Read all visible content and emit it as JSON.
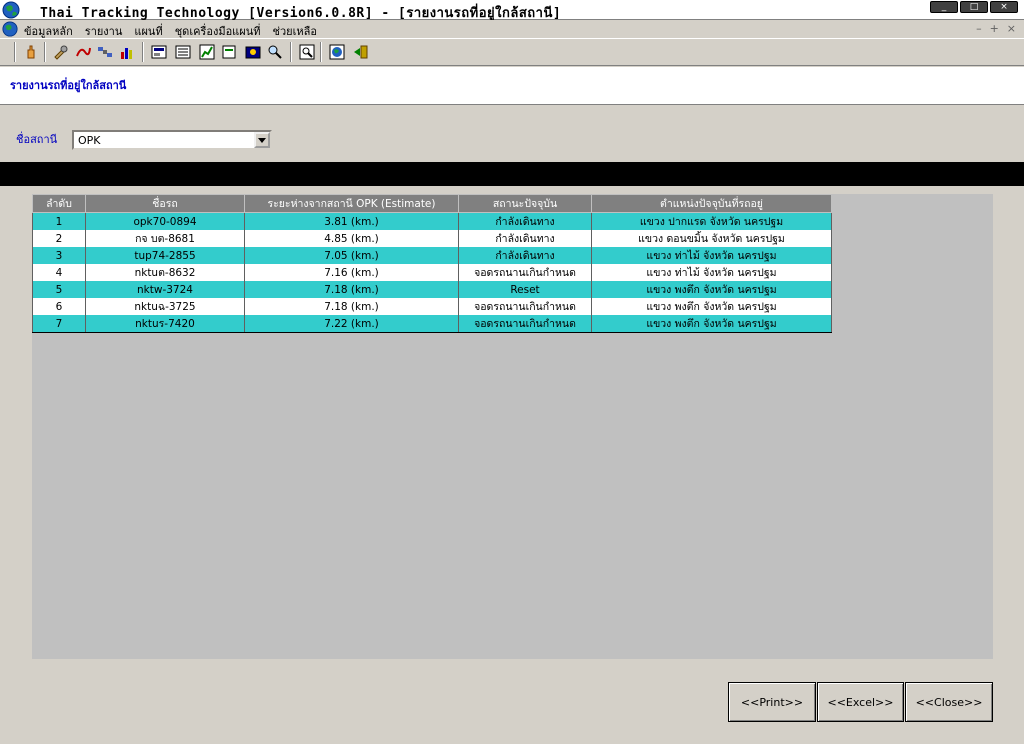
{
  "window": {
    "title": "Thai Tracking Technology [Version6.0.8R] - [รายงานรถที่อยู่ใกล้สถานี]",
    "controls": [
      "_",
      "□",
      "×"
    ]
  },
  "menu": {
    "items": [
      "ข้อมูลหลัก",
      "รายงาน",
      "แผนที่",
      "ชุดเครื่องมือแผนที่",
      "ช่วยเหลือ"
    ],
    "mdi_controls": [
      "–",
      "+",
      "×"
    ]
  },
  "page": {
    "title": "รายงานรถที่อยู่ใกล้สถานี"
  },
  "filter": {
    "label": "ชื่อสถานี",
    "station_value": "OPK"
  },
  "table": {
    "headers": [
      "ลำดับ",
      "ชื่อรถ",
      "ระยะห่างจากสถานี OPK (Estimate)",
      "สถานะปัจจุบัน",
      "ตำแหน่งปัจจุบันที่รถอยู่"
    ],
    "rows": [
      [
        "1",
        "opk70-0894",
        "3.81 (km.)",
        "กำลังเดินทาง",
        "แขวง ปากแรด จังหวัด นครปฐม"
      ],
      [
        "2",
        "กจ บต-8681",
        "4.85 (km.)",
        "กำลังเดินทาง",
        "แขวง ดอนขมิ้น จังหวัด นครปฐม"
      ],
      [
        "3",
        "tup74-2855",
        "7.05 (km.)",
        "กำลังเดินทาง",
        "แขวง ท่าไม้ จังหวัด นครปฐม"
      ],
      [
        "4",
        "nktuต-8632",
        "7.16 (km.)",
        "จอดรถนานเกินกำหนด",
        "แขวง ท่าไม้ จังหวัด นครปฐม"
      ],
      [
        "5",
        "nktw-3724",
        "7.18 (km.)",
        "Reset",
        "แขวง พงตึก จังหวัด นครปฐม"
      ],
      [
        "6",
        "nktuฉ-3725",
        "7.18 (km.)",
        "จอดรถนานเกินกำหนด",
        "แขวง พงตึก จังหวัด นครปฐม"
      ],
      [
        "7",
        "nktuร-7420",
        "7.22 (km.)",
        "จอดรถนานเกินกำหนด",
        "แขวง พงตึก จังหวัด นครปฐม"
      ]
    ]
  },
  "buttons": {
    "print": "<<Print>>",
    "excel": "<<Excel>>",
    "close": "<<Close>>"
  },
  "colors": {
    "row_alt": "#33cccc",
    "header_bg": "#808080",
    "title_text": "#0000c0"
  },
  "toolbar_icons": [
    "hand-icon",
    "tools-icon",
    "route-icon",
    "satellite-icon",
    "chart-icon",
    "map-icon",
    "report-icon",
    "graph-icon",
    "document-icon",
    "camera-icon",
    "search-car-icon",
    "zoom-icon",
    "globe-icon",
    "exit-icon"
  ]
}
